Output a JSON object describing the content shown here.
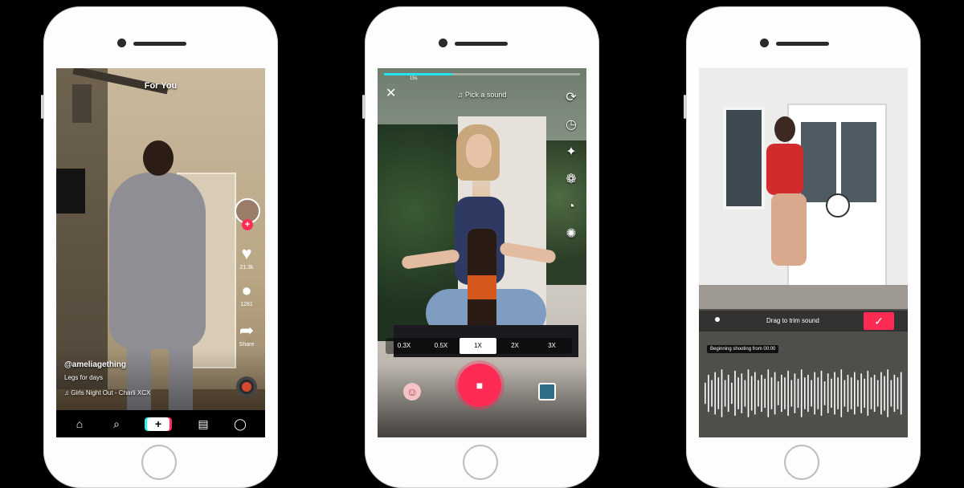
{
  "phone1": {
    "header": {
      "for_you": "For You"
    },
    "actions": {
      "like_count": "21.3k",
      "comment_count": "1281",
      "share_label": "Share"
    },
    "post": {
      "username": "@ameliagething",
      "caption": "Legs for days",
      "sound": "♫  Girls Night Out - Charli XCX"
    },
    "nav": {
      "home": "⌂",
      "discover": "⌕",
      "create": "+",
      "inbox": "▤",
      "profile": "◯"
    }
  },
  "phone2": {
    "header": {
      "close": "✕",
      "pick_sound": "♫  Pick a sound"
    },
    "progress": {
      "fill_fraction": 0.35,
      "mark": "15s"
    },
    "tools": [
      "⟳",
      "◷",
      "✦",
      "❁",
      "◔",
      "✺"
    ],
    "speeds": [
      "0.3X",
      "0.5X",
      "1X",
      "2X",
      "3X"
    ],
    "selected_speed": "1X",
    "record_icon": "■",
    "effects_icon": "☺"
  },
  "phone3": {
    "trim": {
      "label": "Drag to trim sound",
      "confirm": "✓"
    },
    "tooltip": "Beginning shooting from 00:00",
    "waveform_levels": [
      0.4,
      0.7,
      0.5,
      0.8,
      0.6,
      0.9,
      0.5,
      0.7,
      0.4,
      0.85,
      0.6,
      0.75,
      0.5,
      0.9,
      0.65,
      0.8,
      0.5,
      0.7,
      0.55,
      0.9,
      0.6,
      0.8,
      0.45,
      0.7,
      0.6,
      0.85,
      0.5,
      0.75,
      0.55,
      0.9,
      0.6,
      0.7,
      0.5,
      0.8,
      0.6,
      0.85,
      0.45,
      0.75,
      0.55,
      0.8,
      0.6,
      0.9,
      0.5,
      0.7,
      0.6,
      0.8,
      0.5,
      0.75,
      0.55,
      0.85,
      0.6,
      0.7,
      0.5,
      0.8,
      0.65,
      0.9,
      0.5,
      0.7,
      0.6,
      0.8
    ]
  }
}
